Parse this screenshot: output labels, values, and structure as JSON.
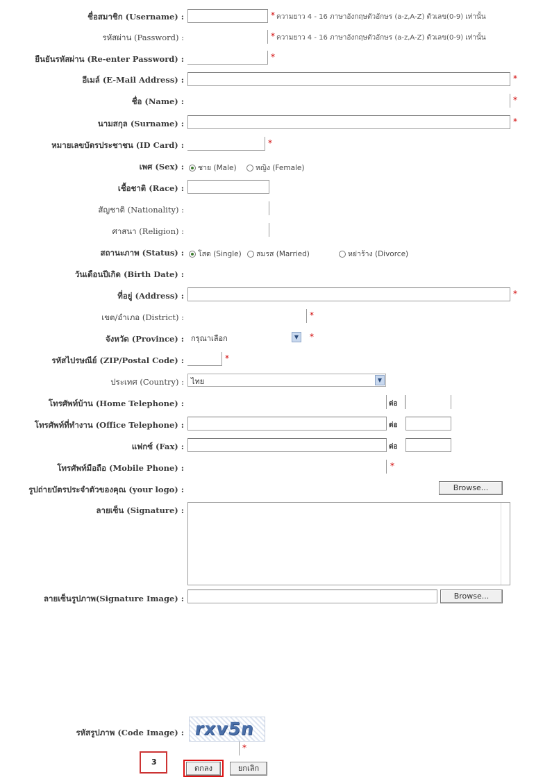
{
  "fields": {
    "username": {
      "label": "ชื่อสมาชิก (Username) :",
      "hint": "ความยาว 4 - 16 ภาษาอังกฤษตัวอักษร (a-z,A-Z) ตัวเลข(0-9) เท่านั้น"
    },
    "password": {
      "label": "รหัสผ่าน (Password) :",
      "hint": "ความยาว 4 - 16 ภาษาอังกฤษตัวอักษร (a-z,A-Z) ตัวเลข(0-9) เท่านั้น"
    },
    "reenter_password": {
      "label": "ยืนยันรหัสผ่าน (Re-enter Password) :"
    },
    "email": {
      "label": "อีเมล์ (E-Mail Address) :"
    },
    "name": {
      "label": "ชื่อ (Name) :"
    },
    "surname": {
      "label": "นามสกุล (Surname) :"
    },
    "id_card": {
      "label": "หมายเลขบัตรประชาชน (ID Card) :"
    },
    "sex": {
      "label": "เพศ (Sex) :",
      "options": [
        "ชาย (Male)",
        "หญิง (Female)"
      ]
    },
    "race": {
      "label": "เชื้อชาติ (Race) :"
    },
    "nationality": {
      "label": "สัญชาติ (Nationality) :"
    },
    "religion": {
      "label": "ศาสนา (Religion) :"
    },
    "status": {
      "label": "สถานะภาพ (Status) :",
      "options": [
        "โสด (Single)",
        "สมรส (Married)",
        "หย่าร้าง (Divorce)"
      ]
    },
    "birth_date": {
      "label": "วันเดือนปีเกิด (Birth Date) :"
    },
    "address": {
      "label": "ที่อยู่ (Address) :"
    },
    "district": {
      "label": "เขต/อำเภอ (District) :"
    },
    "province": {
      "label": "จังหวัด (Province) :",
      "value": "กรุณาเลือก"
    },
    "zip": {
      "label": "รหัสไปรษณีย์ (ZIP/Postal Code) :"
    },
    "country": {
      "label": "ประเทศ (Country) :",
      "value": "ไทย"
    },
    "home_phone": {
      "label": "โทรศัพท์บ้าน (Home Telephone) :",
      "ext": "ต่อ"
    },
    "office_phone": {
      "label": "โทรศัพท์ที่ทำงาน (Office Telephone) :",
      "ext": "ต่อ"
    },
    "fax": {
      "label": "แฟกซ์ (Fax) :",
      "ext": "ต่อ"
    },
    "mobile": {
      "label": "โทรศัพท์มือถือ (Mobile Phone) :"
    },
    "id_photo": {
      "label": "รูปถ่ายบัตรประจำตัวของคุณ (your logo) :",
      "button": "Browse..."
    },
    "signature": {
      "label": "ลายเซ็น (Signature) :"
    },
    "signature_image": {
      "label": "ลายเซ็นรูปภาพ(Signature Image) :",
      "button": "Browse..."
    },
    "code_image": {
      "label": "รหัสรูปภาพ (Code Image) :",
      "captcha": "rxv5n"
    }
  },
  "required_mark": "*",
  "step_number": "3",
  "actions": {
    "submit": "ตกลง",
    "cancel": "ยกเลิก"
  },
  "colors": {
    "required": "#d00000",
    "highlight": "#d11111",
    "captcha": "#4a6fa8"
  }
}
